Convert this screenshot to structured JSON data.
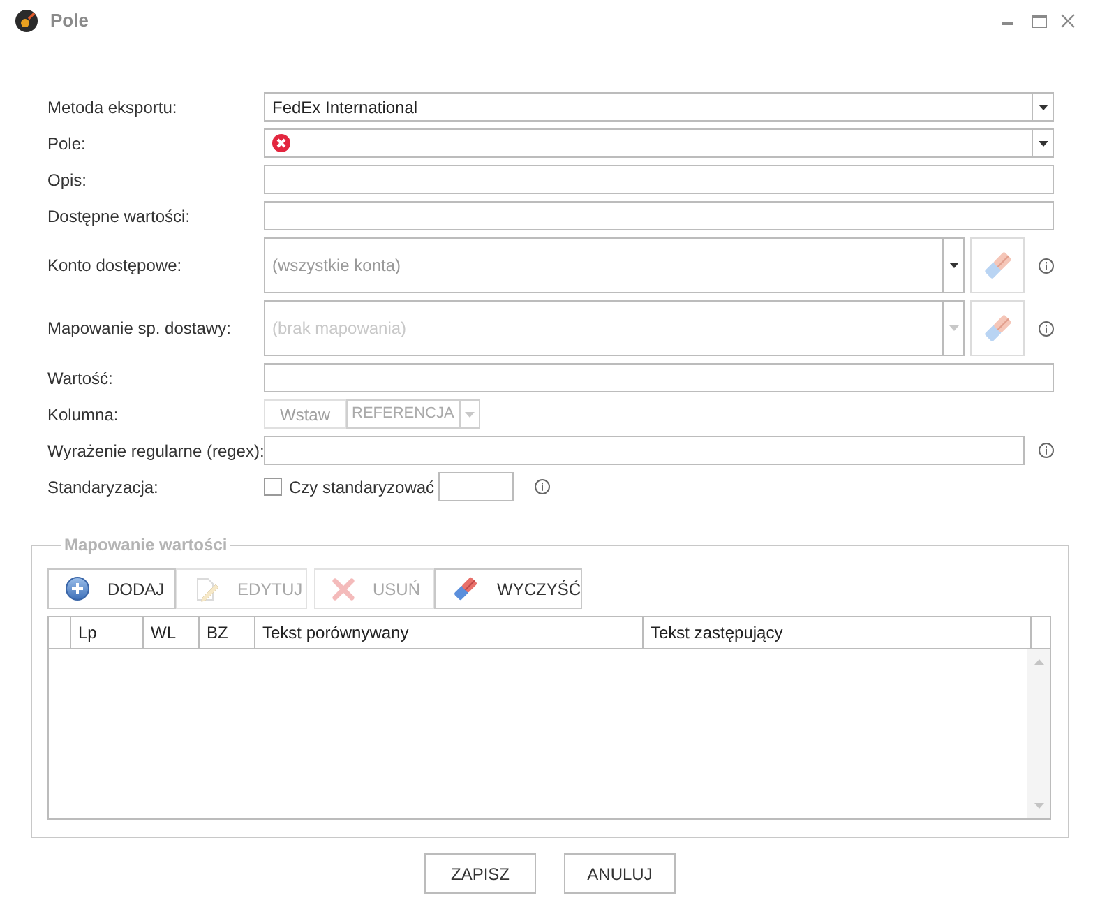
{
  "window": {
    "title": "Pole"
  },
  "form": {
    "fields": [
      {
        "label": "Metoda eksportu:",
        "kind": "combo",
        "value": "FedEx International",
        "disabled": false
      },
      {
        "label": "Pole:",
        "kind": "combo",
        "error": true,
        "disabled": false
      },
      {
        "label": "Opis:",
        "kind": "text"
      },
      {
        "label": "Dostępne wartości:",
        "kind": "text"
      },
      {
        "label": "Konto dostępowe:",
        "kind": "combo_clear",
        "placeholder": "(wszystkie konta)",
        "disabled": false,
        "info": true
      },
      {
        "label": "Mapowanie sp. dostawy:",
        "kind": "combo_clear",
        "placeholder": "(brak mapowania)",
        "disabled": true,
        "info": true
      },
      {
        "label": "Wartość:",
        "kind": "text"
      },
      {
        "label": "Kolumna:",
        "kind": "column",
        "button": "Wstaw",
        "value": "REFERENCJA",
        "disabled": true
      },
      {
        "label": "Wyrażenie regularne (regex):",
        "kind": "text",
        "info": true
      },
      {
        "label": "Standaryzacja:",
        "kind": "checkbox",
        "checkbox_label": "Czy standaryzować",
        "checked": false,
        "info": true
      }
    ]
  },
  "mapping": {
    "legend": "Mapowanie wartości",
    "toolbar": [
      {
        "kind": "add",
        "label": "DODAJ",
        "disabled": false
      },
      {
        "kind": "edit",
        "label": "EDYTUJ",
        "disabled": true
      },
      {
        "kind": "delete",
        "label": "USUŃ",
        "disabled": true
      },
      {
        "kind": "clear",
        "label": "WYCZYŚĆ",
        "disabled": false
      }
    ],
    "table": {
      "columns": [
        "Lp",
        "WL",
        "BZ",
        "Tekst porównywany",
        "Tekst zastępujący"
      ]
    }
  },
  "buttons": [
    "ZAPISZ",
    "ANULUJ"
  ]
}
